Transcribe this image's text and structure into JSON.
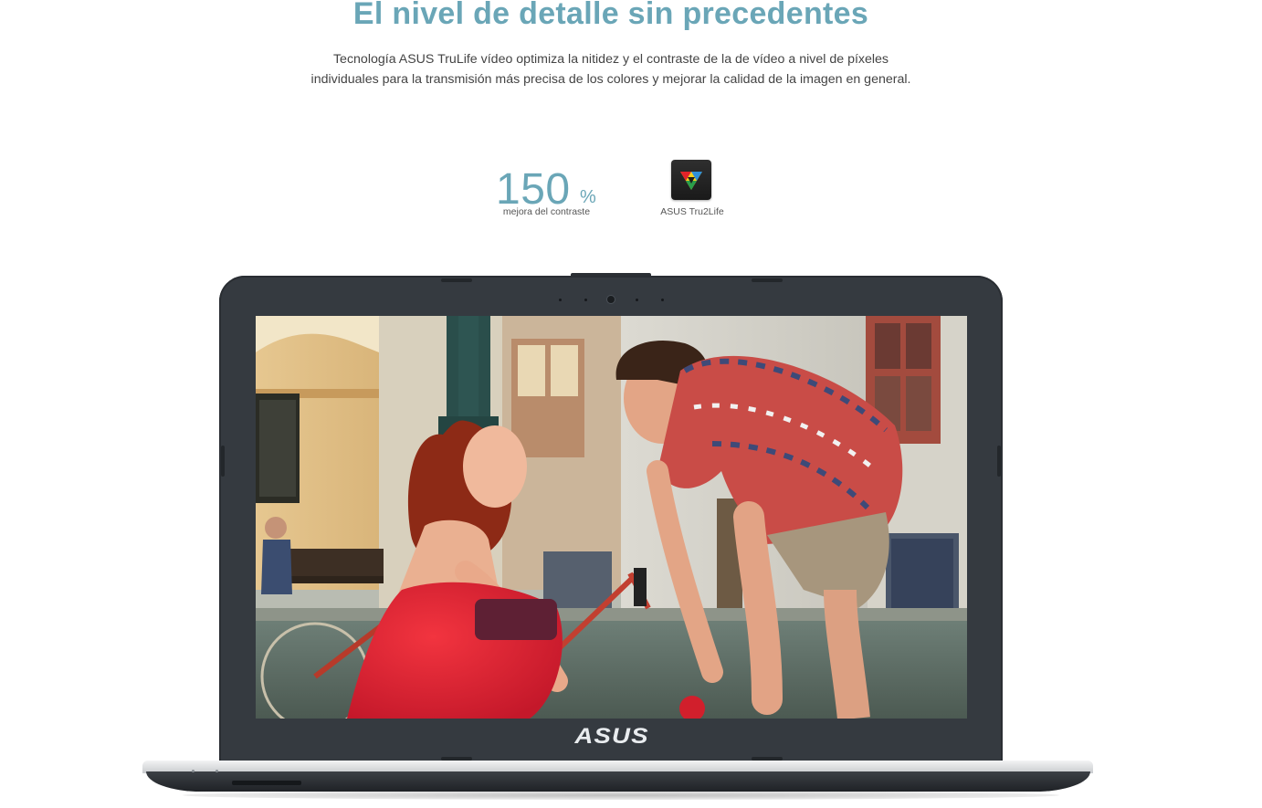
{
  "section": {
    "headline": "El nivel de detalle sin precedentes",
    "description_line1": "Tecnología ASUS TruLife vídeo optimiza la nitidez y el contraste de la de vídeo a nivel de píxeles",
    "description_line2": "individuales para la transmisión más precisa de los colores y mejorar la calidad de la imagen en general."
  },
  "stats": {
    "contrast_value": "150",
    "contrast_unit": "%",
    "contrast_label": "mejora del contraste"
  },
  "feature": {
    "icon": "asus-tru2life-icon",
    "label": "ASUS Tru2Life"
  },
  "laptop": {
    "brand": "ASUS",
    "screen_image": "couple-with-bicycle-photo"
  },
  "colors": {
    "accent": "#6aa6b7",
    "laptop_lid": "#353a40",
    "dress_red": "#e5273a"
  }
}
